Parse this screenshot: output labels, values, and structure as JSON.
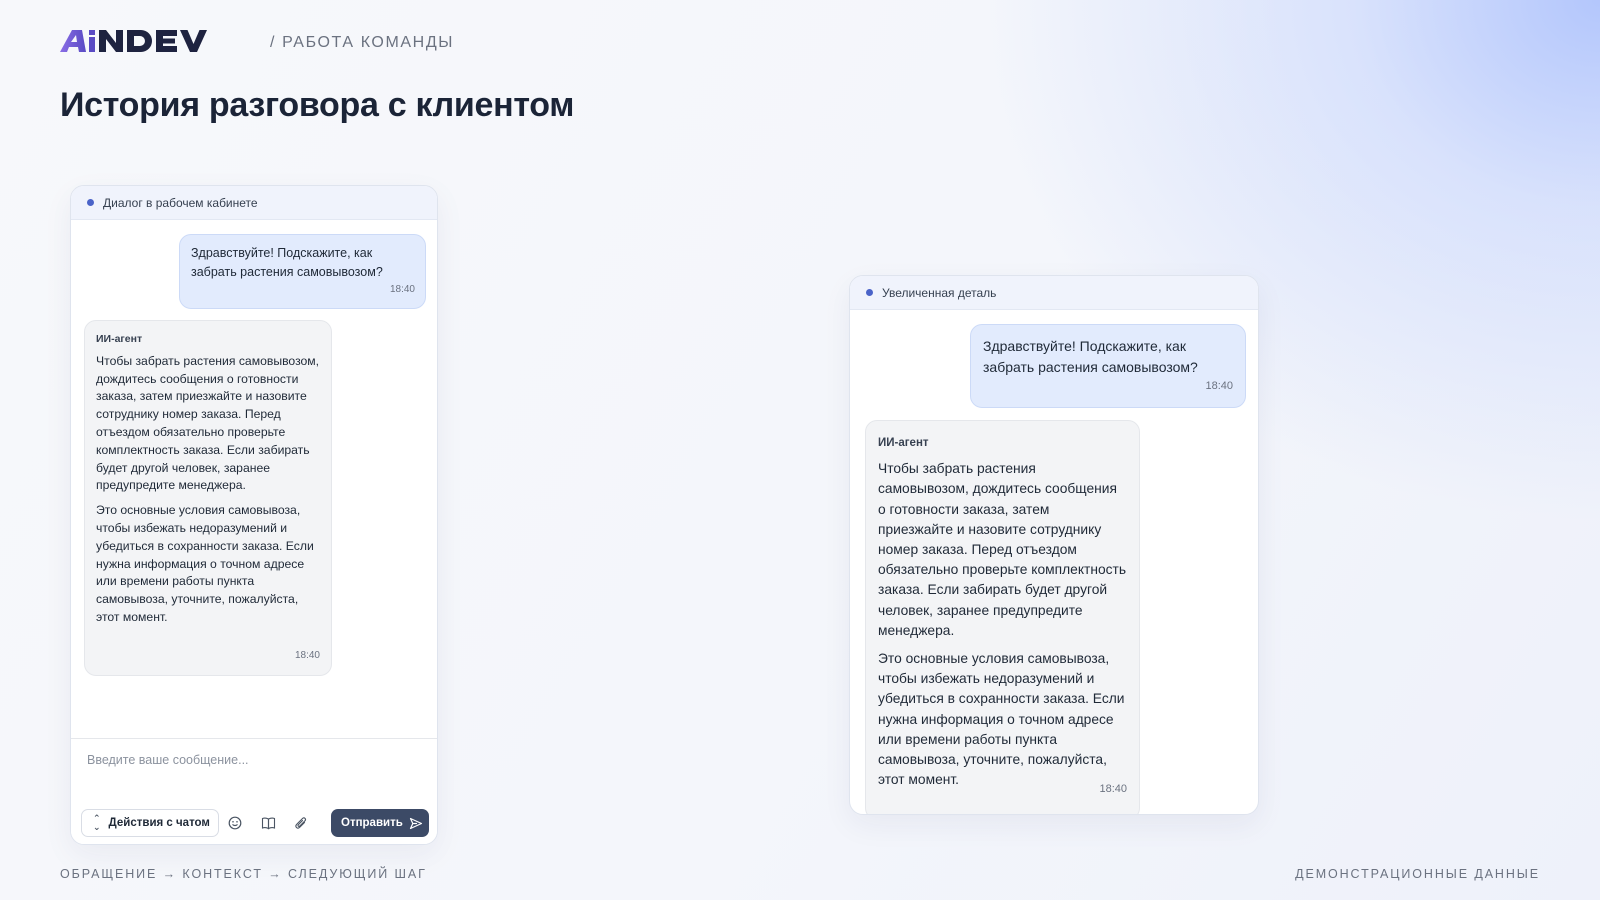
{
  "header": {
    "logo_text": "AiNDEV",
    "breadcrumb": "/ РАБОТА КОМАНДЫ",
    "title": "История разговора с клиентом"
  },
  "colors": {
    "accent": "#4a63c8",
    "logo_gradient": [
      "#6d5ad9",
      "#1e2340"
    ],
    "user_bubble": "#e2ebfd",
    "agent_bubble": "#f3f4f6",
    "send_button": "#3c4a66"
  },
  "chat_panel": {
    "header": "Диалог в рабочем кабинете",
    "user_message": {
      "text": "Здравствуйте! Подскажите, как забрать растения самовывозом?",
      "time": "18:40"
    },
    "agent_message": {
      "sender": "ИИ-агент",
      "paragraphs": [
        "Чтобы забрать растения самовывозом, дождитесь сообщения о готовности заказа, затем приезжайте и назовите сотруднику номер заказа. Перед отъездом обязательно проверьте комплектность заказа. Если забирать будет другой человек, заранее предупредите менеджера.",
        "Это основные условия самовывоза, чтобы избежать недоразумений и убедиться в сохранности заказа. Если нужна информация о точном адресе или времени работы пункта самовывоза, уточните, пожалуйста, этот момент."
      ],
      "time": "18:40"
    },
    "composer": {
      "placeholder": "Введите ваше сообщение...",
      "actions_label": "Действия с чатом",
      "send_label": "Отправить",
      "tools": [
        "emoji-icon",
        "book-icon",
        "paperclip-icon"
      ]
    }
  },
  "detail_panel": {
    "header": "Увеличенная деталь",
    "user_message": {
      "text": "Здравствуйте! Подскажите, как забрать растения самовывозом?",
      "time": "18:40"
    },
    "agent_message": {
      "sender": "ИИ-агент",
      "paragraphs": [
        "Чтобы забрать растения самовывозом, дождитесь сообщения о готовности заказа, затем приезжайте и назовите сотруднику номер заказа. Перед отъездом обязательно проверьте комплектность заказа. Если забирать будет другой человек, заранее предупредите менеджера.",
        "Это основные условия самовывоза, чтобы избежать недоразумений и убедиться в сохранности заказа. Если нужна информация о точном адресе или времени работы пункта самовывоза, уточните, пожалуйста, этот момент."
      ],
      "time": "18:40"
    }
  },
  "footer": {
    "left": "ОБРАЩЕНИЕ → КОНТЕКСТ → СЛЕДУЮЩИЙ ШАГ",
    "right": "ДЕМОНСТРАЦИОННЫЕ ДАННЫЕ"
  }
}
